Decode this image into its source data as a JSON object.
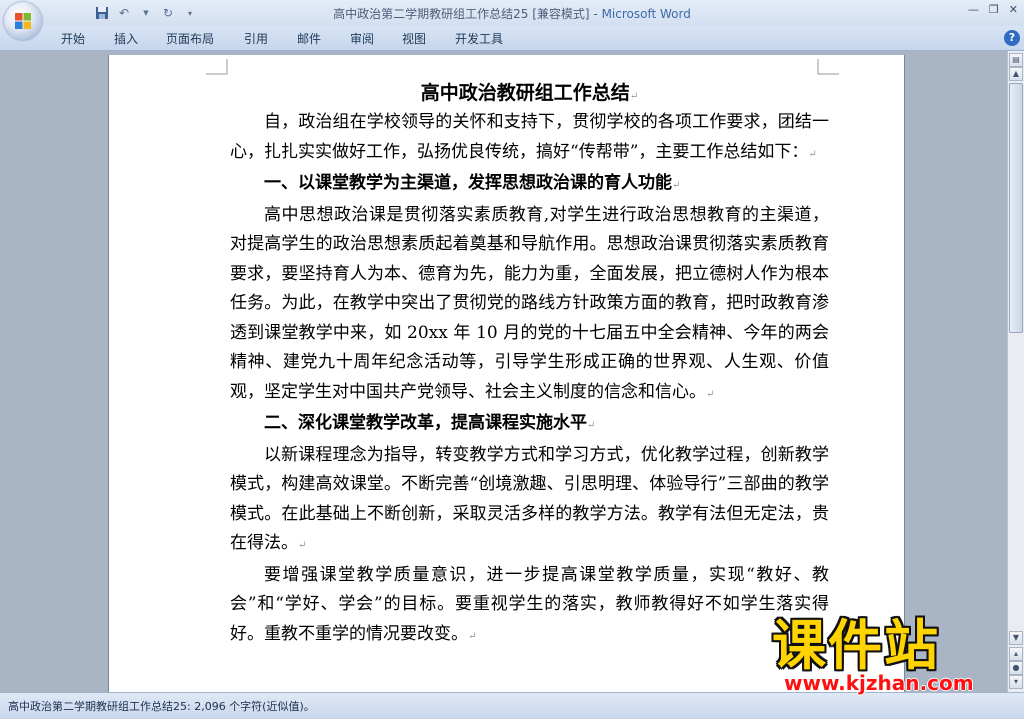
{
  "window": {
    "title_doc": "高中政治第二学期教研组工作总结25 [兼容模式]",
    "title_sep": " - ",
    "title_app": "Microsoft Word"
  },
  "ribbon": {
    "tabs": [
      "开始",
      "插入",
      "页面布局",
      "引用",
      "邮件",
      "审阅",
      "视图",
      "开发工具"
    ]
  },
  "document": {
    "title": "高中政治教研组工作总结",
    "intro": "自，政治组在学校领导的关怀和支持下，贯彻学校的各项工作要求，团结一心，扎扎实实做好工作，弘扬优良传统，搞好“传帮带”，主要工作总结如下：",
    "heading1": "一、以课堂教学为主渠道，发挥思想政治课的育人功能",
    "para1": "高中思想政治课是贯彻落实素质教育,对学生进行政治思想教育的主渠道，对提高学生的政治思想素质起着奠基和导航作用。思想政治课贯彻落实素质教育要求，要坚持育人为本、德育为先，能力为重，全面发展，把立德树人作为根本任务。为此，在教学中突出了贯彻党的路线方针政策方面的教育，把时政教育渗透到课堂教学中来，如 20xx 年 10 月的党的十七届五中全会精神、今年的两会精神、建党九十周年纪念活动等，引导学生形成正确的世界观、人生观、价值观，坚定学生对中国共产党领导、社会主义制度的信念和信心。",
    "heading2": "二、深化课堂教学改革，提高课程实施水平",
    "para2": "以新课程理念为指导，转变教学方式和学习方式，优化教学过程，创新教学模式，构建高效课堂。不断完善“创境激趣、引思明理、体验导行”三部曲的教学模式。在此基础上不断创新，采取灵活多样的教学方法。教学有法但无定法，贵在得法。",
    "para3": "要增强课堂教学质量意识，进一步提高课堂教学质量，实现“教好、教会”和“学好、学会”的目标。要重视学生的落实，教师教得好不如学生落实得好。重教不重学的情况要改变。",
    "para_mark": "↵"
  },
  "statusbar": {
    "text": "高中政治第二学期教研组工作总结25: 2,096 个字符(近似值)。"
  },
  "watermark": {
    "logo": "课件站",
    "url": "www.kjzhan.com"
  },
  "colors": {
    "ribbon_bg": "#d3dff0",
    "workspace_bg": "#a9b4c4",
    "title_app": "#3e6aa8",
    "watermark_yellow": "#ffd400",
    "watermark_red": "#ff1010"
  }
}
